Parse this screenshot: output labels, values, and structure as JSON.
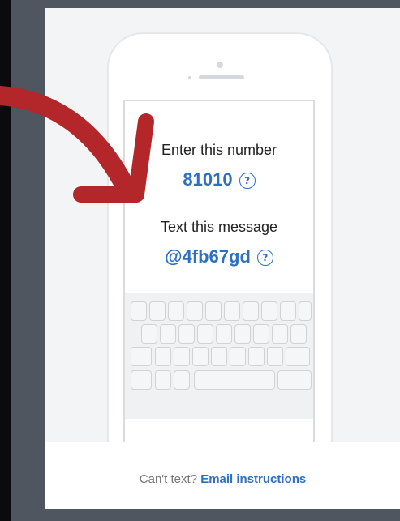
{
  "phone_screen": {
    "number_label": "Enter this number",
    "number_value": "81010",
    "message_label": "Text this message",
    "message_value": "@4fb67gd",
    "help_icon_glyph": "?"
  },
  "footer": {
    "prompt": "Can't text?",
    "link_text": "Email instructions"
  },
  "colors": {
    "background": "#4f5660",
    "card": "#f3f4f5",
    "accent_blue": "#2d6fc1",
    "arrow_red": "#b3262a"
  },
  "icons": [
    "help-icon",
    "red-arrow-annotation"
  ]
}
